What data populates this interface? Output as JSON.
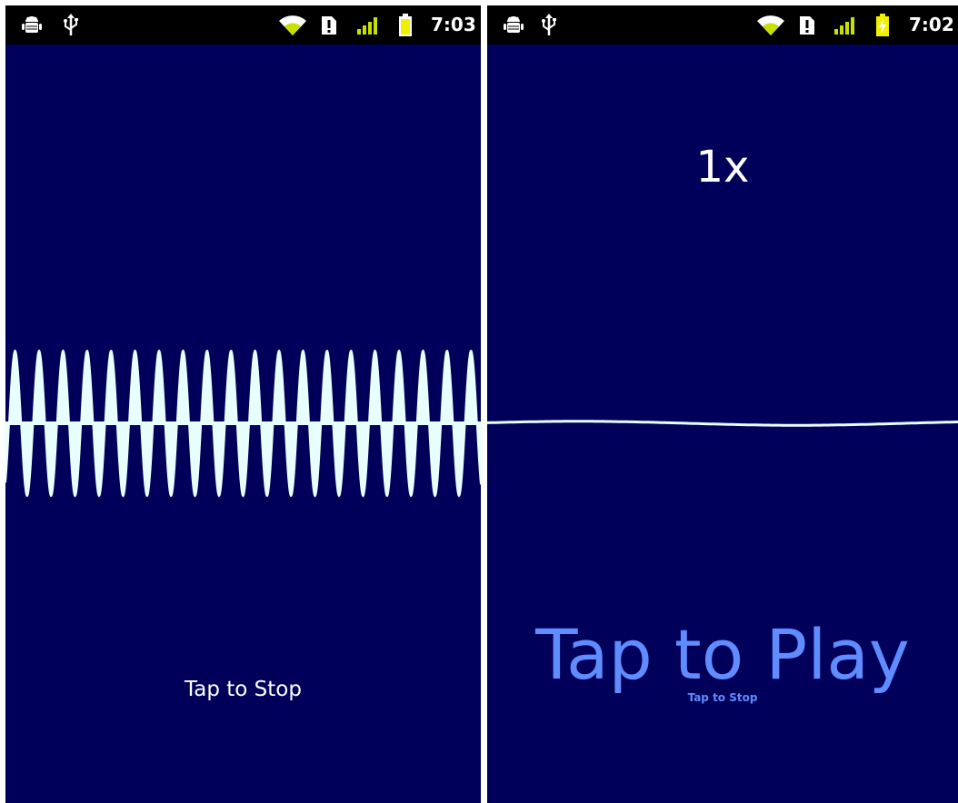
{
  "colors": {
    "background": "#00005a",
    "statusbar": "#000000",
    "wave": "#e8ffff",
    "accent": "#5f8cff",
    "signal": "#c8e000",
    "battery": "#f0f000"
  },
  "left_screen": {
    "status": {
      "icons": [
        "android-debug-icon",
        "usb-icon",
        "wifi-icon",
        "alert-icon",
        "signal-icon",
        "battery-icon"
      ],
      "time": "7:03"
    },
    "button_label": "Tap to Stop"
  },
  "right_screen": {
    "status": {
      "icons": [
        "android-debug-icon",
        "usb-icon",
        "wifi-icon",
        "alert-icon",
        "signal-icon",
        "battery-charging-icon"
      ],
      "time": "7:02"
    },
    "speed_label": "1x",
    "play_label": "Tap to Play",
    "stop_label": "Tap to Stop"
  }
}
